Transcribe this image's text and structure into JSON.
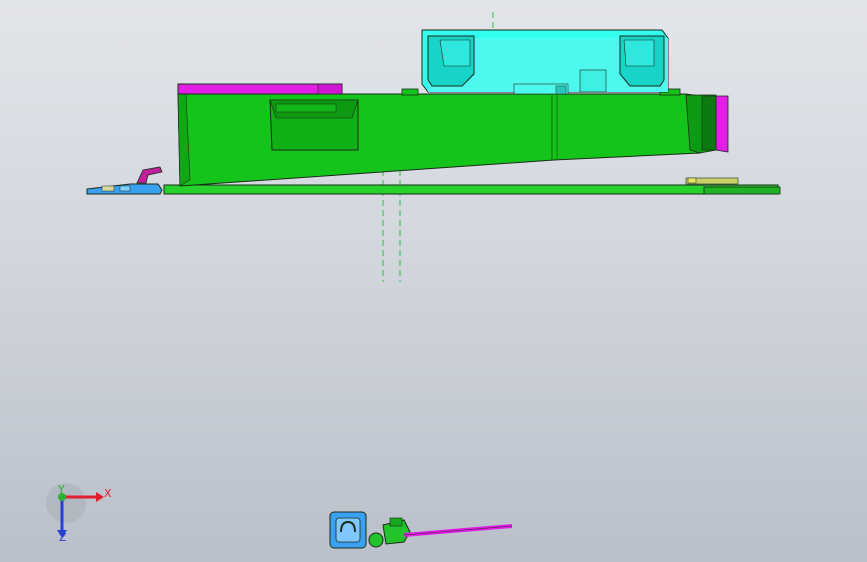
{
  "viewport": {
    "background_top": "#e3e5ea",
    "background_bottom": "#b9c0ca"
  },
  "model": {
    "colors": {
      "housing": "#15c41a",
      "housing_dark": "#0f9a14",
      "fan": "#33ffee",
      "fan_dark": "#14c9c0",
      "magenta": "#e21ee6",
      "board": "#26d12c",
      "clip": "#3aa0f0",
      "centerline": "#27c23a",
      "edge": "#1a2a1a"
    },
    "parts": [
      "fan-module",
      "housing-body",
      "pcb-board",
      "magenta-cover",
      "side-clip",
      "dashed-centerline"
    ]
  },
  "triad": {
    "x_label": "X",
    "y_label": "Y",
    "z_label": "Z",
    "x_color": "#e0202a",
    "y_color": "#2fb034",
    "z_color": "#2a3fd0"
  },
  "mini_preview": {
    "icon": "assembly-preview-icon"
  }
}
